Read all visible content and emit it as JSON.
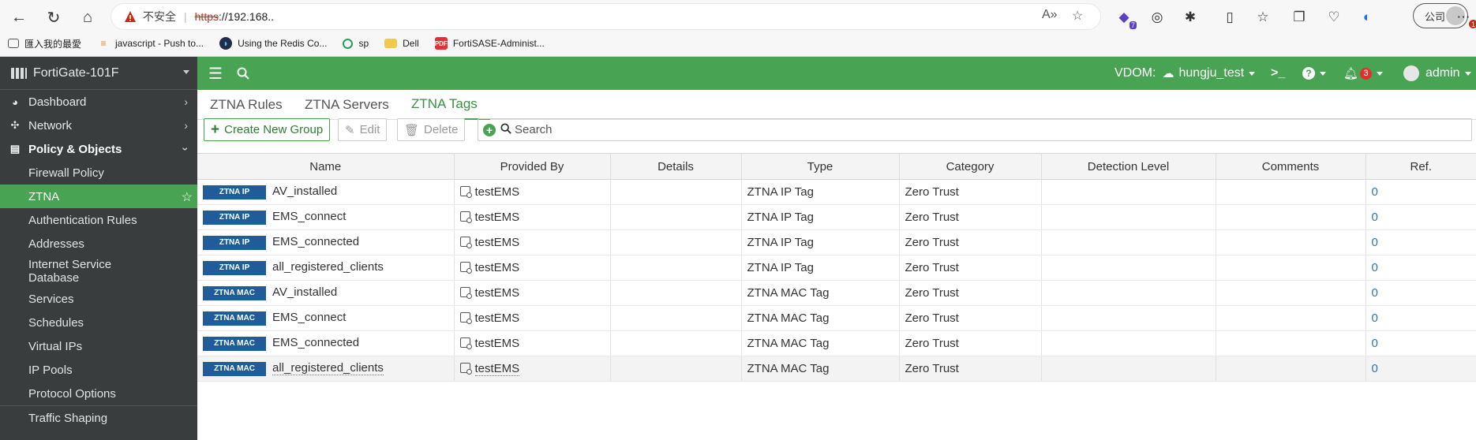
{
  "browser": {
    "address": {
      "insecure_label": "不安全",
      "scheme": "https",
      "host": "://192.168.. "
    },
    "profile_label": "公司",
    "tab_count_badge": "7",
    "alert_badge": "1",
    "bookmarks": [
      {
        "label": "匯入我的最愛",
        "icon": "folder-import-icon"
      },
      {
        "label": "javascript - Push to...",
        "icon": "stackoverflow-icon"
      },
      {
        "label": "Using the Redis Co...",
        "icon": "redis-icon"
      },
      {
        "label": "sp",
        "icon": "sharepoint-icon"
      },
      {
        "label": "Dell",
        "icon": "folder-icon"
      },
      {
        "label": "FortiSASE-Administ...",
        "icon": "pdf-icon"
      }
    ]
  },
  "sidebar": {
    "device": "FortiGate-101F",
    "items": [
      {
        "label": "Dashboard",
        "icon": "dashboard-icon"
      },
      {
        "label": "Network",
        "icon": "network-icon"
      },
      {
        "label": "Policy & Objects",
        "icon": "policy-icon"
      }
    ],
    "subitems": [
      "Firewall Policy",
      "ZTNA",
      "Authentication Rules",
      "Addresses",
      "Internet Service Database",
      "Services",
      "Schedules",
      "Virtual IPs",
      "IP Pools",
      "Protocol Options",
      "Traffic Shaping"
    ]
  },
  "topbar": {
    "vdom_label": "VDOM:",
    "vdom_value": "hungju_test",
    "notifications": "3",
    "user": "admin"
  },
  "tabs": [
    "ZTNA Rules",
    "ZTNA Servers",
    "ZTNA Tags"
  ],
  "toolbar": {
    "create": "Create New Group",
    "edit": "Edit",
    "delete": "Delete",
    "search_placeholder": "Search"
  },
  "table": {
    "columns": [
      "Name",
      "Provided By",
      "Details",
      "Type",
      "Category",
      "Detection Level",
      "Comments",
      "Ref."
    ],
    "rows": [
      {
        "tag": "ZTNA IP",
        "name": "AV_installed",
        "provider": "testEMS",
        "details": "",
        "type": "ZTNA IP Tag",
        "category": "Zero Trust",
        "level": "",
        "comments": "",
        "ref": "0"
      },
      {
        "tag": "ZTNA IP",
        "name": "EMS_connect",
        "provider": "testEMS",
        "details": "",
        "type": "ZTNA IP Tag",
        "category": "Zero Trust",
        "level": "",
        "comments": "",
        "ref": "0"
      },
      {
        "tag": "ZTNA IP",
        "name": "EMS_connected",
        "provider": "testEMS",
        "details": "",
        "type": "ZTNA IP Tag",
        "category": "Zero Trust",
        "level": "",
        "comments": "",
        "ref": "0"
      },
      {
        "tag": "ZTNA IP",
        "name": "all_registered_clients",
        "provider": "testEMS",
        "details": "",
        "type": "ZTNA IP Tag",
        "category": "Zero Trust",
        "level": "",
        "comments": "",
        "ref": "0"
      },
      {
        "tag": "ZTNA MAC",
        "name": "AV_installed",
        "provider": "testEMS",
        "details": "",
        "type": "ZTNA MAC Tag",
        "category": "Zero Trust",
        "level": "",
        "comments": "",
        "ref": "0"
      },
      {
        "tag": "ZTNA MAC",
        "name": "EMS_connect",
        "provider": "testEMS",
        "details": "",
        "type": "ZTNA MAC Tag",
        "category": "Zero Trust",
        "level": "",
        "comments": "",
        "ref": "0"
      },
      {
        "tag": "ZTNA MAC",
        "name": "EMS_connected",
        "provider": "testEMS",
        "details": "",
        "type": "ZTNA MAC Tag",
        "category": "Zero Trust",
        "level": "",
        "comments": "",
        "ref": "0"
      },
      {
        "tag": "ZTNA MAC",
        "name": "all_registered_clients",
        "provider": "testEMS",
        "details": "",
        "type": "ZTNA MAC Tag",
        "category": "Zero Trust",
        "level": "",
        "comments": "",
        "ref": "0"
      }
    ]
  }
}
